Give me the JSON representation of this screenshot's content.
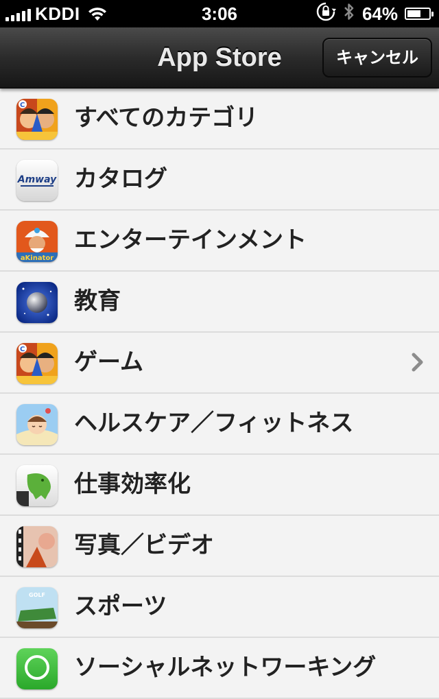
{
  "status_bar": {
    "carrier": "KDDI",
    "time": "3:06",
    "battery_percent_label": "64%",
    "battery_level": 0.64
  },
  "nav": {
    "title": "App Store",
    "cancel_label": "キャンセル"
  },
  "categories": [
    {
      "label": "すべてのカテゴリ",
      "icon": "game-center-app-icon",
      "chevron": false
    },
    {
      "label": "カタログ",
      "icon": "amway-app-icon",
      "icon_text": "Amway",
      "chevron": false
    },
    {
      "label": "エンターテインメント",
      "icon": "akinator-app-icon",
      "icon_text": "aKinator",
      "chevron": false
    },
    {
      "label": "教育",
      "icon": "night-sky-app-icon",
      "chevron": false
    },
    {
      "label": "ゲーム",
      "icon": "game-center-app-icon",
      "chevron": true
    },
    {
      "label": "ヘルスケア／フィットネス",
      "icon": "baby-sleep-app-icon",
      "chevron": false
    },
    {
      "label": "仕事効率化",
      "icon": "evernote-app-icon",
      "chevron": false
    },
    {
      "label": "写真／ビデオ",
      "icon": "photo-video-app-icon",
      "chevron": false
    },
    {
      "label": "スポーツ",
      "icon": "golf-app-icon",
      "icon_text": "GOLF",
      "chevron": false
    },
    {
      "label": "ソーシャルネットワーキング",
      "icon": "whatsapp-app-icon",
      "chevron": false
    }
  ]
}
